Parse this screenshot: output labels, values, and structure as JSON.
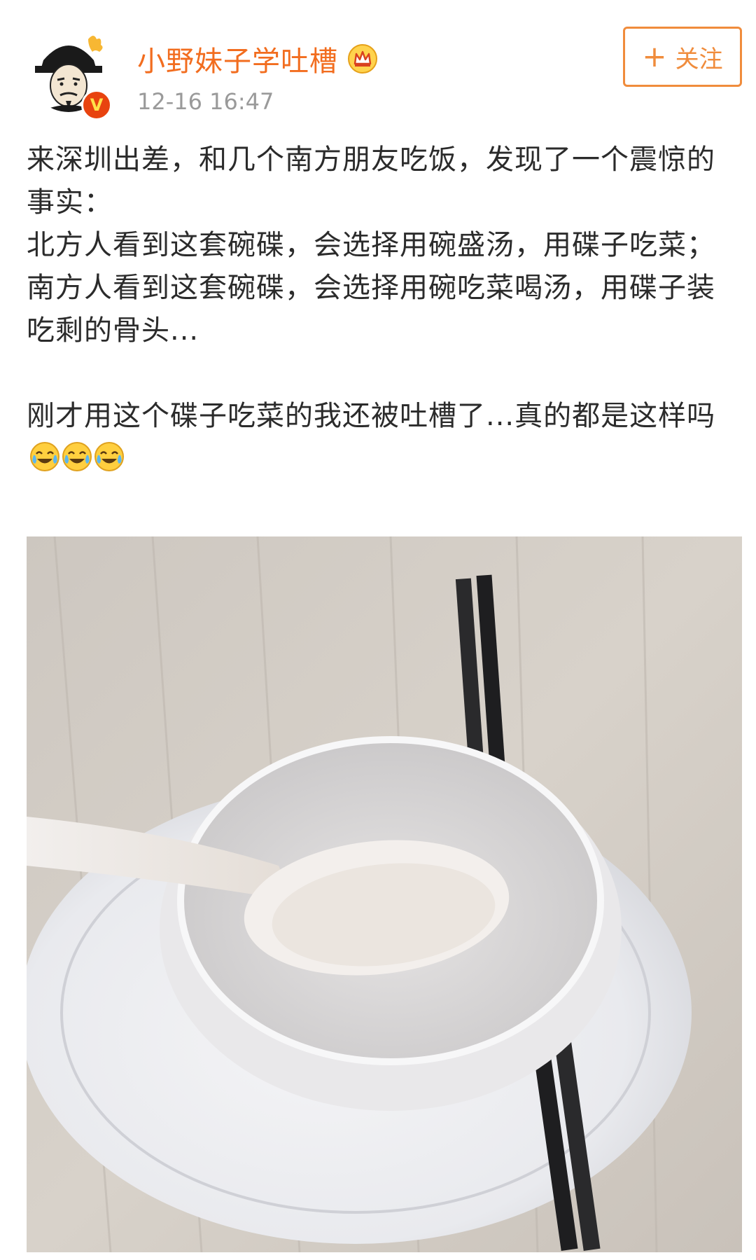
{
  "post": {
    "author": {
      "name": "小野妹子学吐槽",
      "verified_badge": "V",
      "badge_icon": "crown-icon"
    },
    "timestamp": "12-16 16:47",
    "follow_button": {
      "plus": "+",
      "label": "关注"
    },
    "lines": [
      "来深圳出差，和几个南方朋友吃饭，发现了一个震惊的事实：",
      "北方人看到这套碗碟，会选择用碗盛汤，用碟子吃菜；",
      "南方人看到这套碗碟，会选择用碗吃菜喝汤，用碟子装吃剩的骨头...",
      "刚才用这个碟子吃菜的我还被吐槽了...真的都是这样吗"
    ],
    "emojis": [
      "laugh-cry-emoji",
      "laugh-cry-emoji",
      "laugh-cry-emoji"
    ],
    "photo_icon": "bowl-plate-chopsticks-photo"
  },
  "colors": {
    "accent_orange": "#f08c3c",
    "username_orange": "#f26d1f",
    "text": "#2b2b2b",
    "meta_gray": "#9a9a9a",
    "verified_red": "#e8430f"
  }
}
